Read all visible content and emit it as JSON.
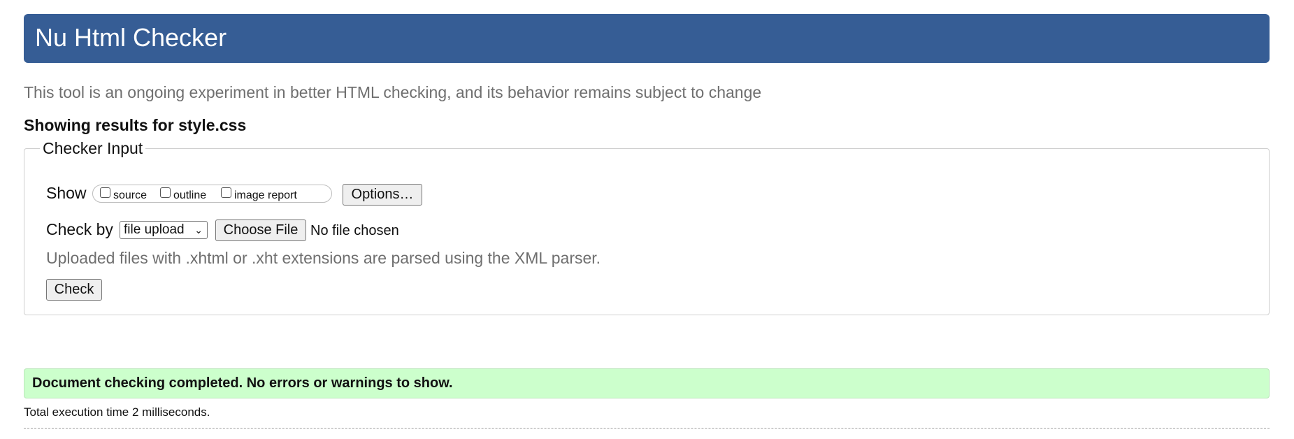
{
  "header": {
    "title": "Nu Html Checker"
  },
  "tagline": "This tool is an ongoing experiment in better HTML checking, and its behavior remains subject to change",
  "showing_results": "Showing results for style.css",
  "checker_input": {
    "legend": "Checker Input",
    "show_label": "Show",
    "show_options": [
      {
        "label": "source",
        "checked": false
      },
      {
        "label": "outline",
        "checked": false
      },
      {
        "label": "image report",
        "checked": false
      }
    ],
    "options_button": "Options…",
    "check_by_label": "Check by",
    "check_by_selected": "file upload",
    "choose_file_button": "Choose File",
    "no_file_text": "No file chosen",
    "parser_note": "Uploaded files with .xhtml or .xht extensions are parsed using the XML parser.",
    "check_button": "Check"
  },
  "result": {
    "message": "Document checking completed. No errors or warnings to show.",
    "execution_time": "Total execution time 2 milliseconds."
  },
  "colors": {
    "header_bg": "#365d95",
    "success_bg": "#ccffcc"
  }
}
